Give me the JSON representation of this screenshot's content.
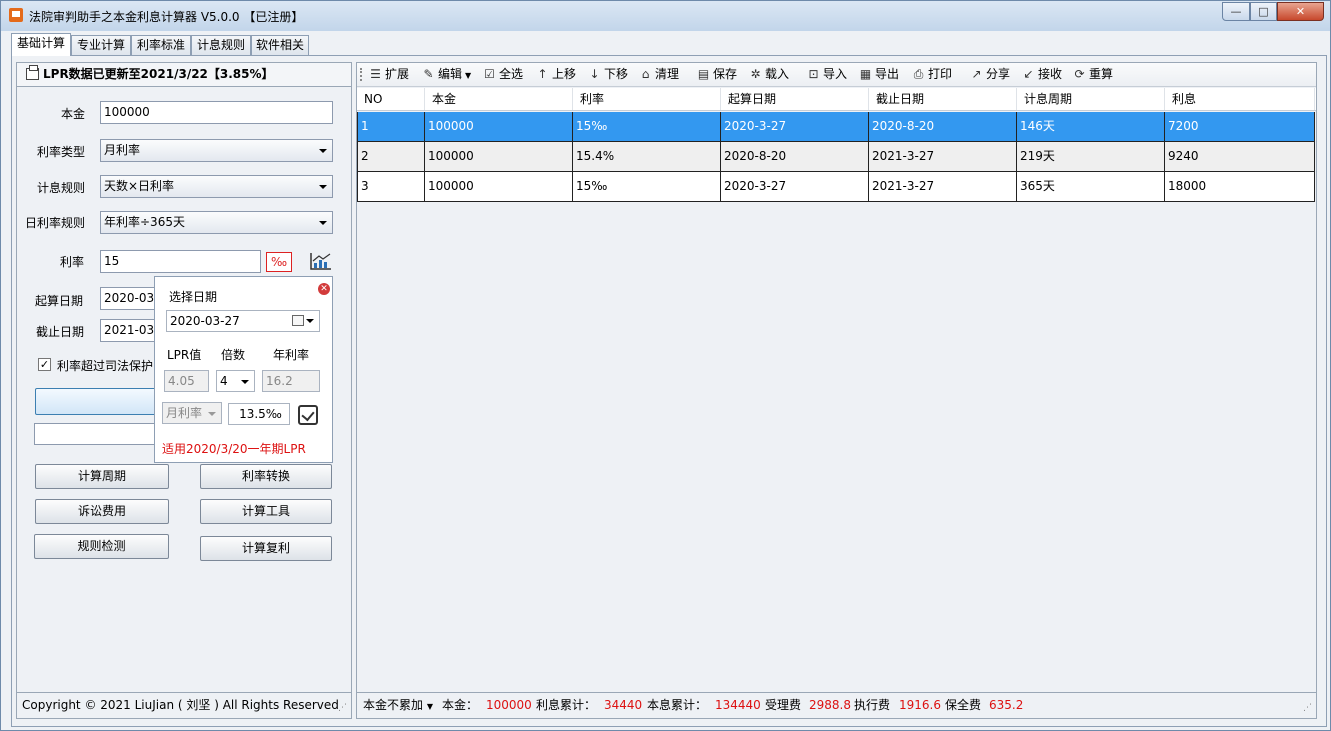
{
  "window": {
    "title": "法院审判助手之本金利息计算器 V5.0.0 【已注册】",
    "btn_min": "—",
    "btn_max": "□",
    "btn_close": "✕"
  },
  "tabs": [
    {
      "label": "基础计算"
    },
    {
      "label": "专业计算"
    },
    {
      "label": "利率标准"
    },
    {
      "label": "计息规则"
    },
    {
      "label": "软件相关"
    }
  ],
  "left": {
    "header": "LPR数据已更新至2021/3/22【3.85%】",
    "principal_label": "本金",
    "principal_value": "100000",
    "rate_type_label": "利率类型",
    "rate_type_value": "月利率",
    "interest_rule_label": "计息规则",
    "interest_rule_value": "天数×日利率",
    "daily_rate_rule_label": "日利率规则",
    "daily_rate_rule_value": "年利率÷365天",
    "rate_label": "利率",
    "rate_value": "15",
    "rate_unit": "‰",
    "start_date_label": "起算日期",
    "start_date_value": "2020-03",
    "end_date_label": "截止日期",
    "end_date_value": "2021-03",
    "protect_checkbox": "利率超过司法保护",
    "buttons": {
      "calc_period": "计算周期",
      "rate_convert": "利率转换",
      "litigation_fee": "诉讼费用",
      "calc_tools": "计算工具",
      "rule_check": "规则检测",
      "compound": "计算复利"
    },
    "footer": "Copyright © 2021 LiuJian ( 刘坚 )  All Rights Reserved"
  },
  "popup": {
    "title": "选择日期",
    "date_value": "2020-03-27",
    "lpr_label": "LPR值",
    "multiple_label": "倍数",
    "annual_label": "年利率",
    "lpr_value": "4.05",
    "multiple_value": "4",
    "annual_value": "16.2",
    "rate_type_value": "月利率",
    "result_value": "13.5‰",
    "note": "适用2020/3/20一年期LPR"
  },
  "toolbar": [
    {
      "label": "扩展",
      "icon": "expand-icon"
    },
    {
      "label": "编辑",
      "icon": "edit-icon"
    },
    {
      "label": "全选",
      "icon": "select-all-icon"
    },
    {
      "label": "上移",
      "icon": "arrow-up-icon"
    },
    {
      "label": "下移",
      "icon": "arrow-down-icon"
    },
    {
      "label": "清理",
      "icon": "clear-icon"
    },
    {
      "label": "保存",
      "icon": "save-icon"
    },
    {
      "label": "载入",
      "icon": "load-icon"
    },
    {
      "label": "导入",
      "icon": "import-icon"
    },
    {
      "label": "导出",
      "icon": "export-icon"
    },
    {
      "label": "打印",
      "icon": "print-icon"
    },
    {
      "label": "分享",
      "icon": "share-icon"
    },
    {
      "label": "接收",
      "icon": "receive-icon"
    },
    {
      "label": "重算",
      "icon": "recalc-icon"
    }
  ],
  "table": {
    "columns": [
      "NO",
      "本金",
      "利率",
      "起算日期",
      "截止日期",
      "计息周期",
      "利息"
    ],
    "rows": [
      [
        "1",
        "100000",
        "15‰",
        "2020-3-27",
        "2020-8-20",
        "146天",
        "7200"
      ],
      [
        "2",
        "100000",
        "15.4%",
        "2020-8-20",
        "2021-3-27",
        "219天",
        "9240"
      ],
      [
        "3",
        "100000",
        "15‰",
        "2020-3-27",
        "2021-3-27",
        "365天",
        "18000"
      ]
    ],
    "selected_row": 0
  },
  "status": {
    "mode": "本金不累加",
    "principal_label": "本金：",
    "principal_value": "100000",
    "interest_label": "利息累计：",
    "interest_value": "34440",
    "total_label": "本息累计：",
    "total_value": "134440",
    "accept_fee_label": "受理费",
    "accept_fee_value": "2988.8",
    "exec_fee_label": "执行费",
    "exec_fee_value": "1916.6",
    "preserve_fee_label": "保全费",
    "preserve_fee_value": "635.2"
  },
  "colors": {
    "selection": "#3398f0",
    "accent_red": "#dd1111"
  }
}
